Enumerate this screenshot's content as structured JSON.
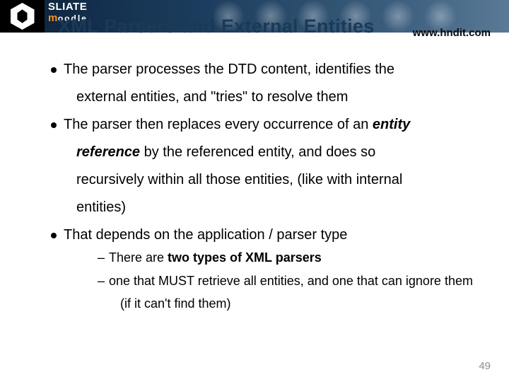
{
  "header": {
    "brand_line1": "SLIATE",
    "brand_line2_m": "m",
    "brand_line2_rest": "oodle",
    "site": "www.hndit.com"
  },
  "title": "XML Parsers and External Entities",
  "bullets": [
    {
      "line1": "The parser processes the DTD content, identifies the",
      "line2": "external entities, and \"tries\" to resolve them"
    },
    {
      "line1_pre": "The parser then replaces every occurrence of an ",
      "line1_em": "entity",
      "line2_em": "reference",
      "line2_post": " by the referenced entity, and does so",
      "line3": "recursively within all those entities, (like with internal",
      "line4": "entities)"
    },
    {
      "line1": "That depends on the application / parser type",
      "sub": [
        {
          "pre": "There are ",
          "bold": "two types of XML parsers"
        },
        {
          "text": "one that MUST retrieve all entities, and one that can ignore them",
          "cont": "(if it can't find them)"
        }
      ]
    }
  ],
  "page_number": "49"
}
